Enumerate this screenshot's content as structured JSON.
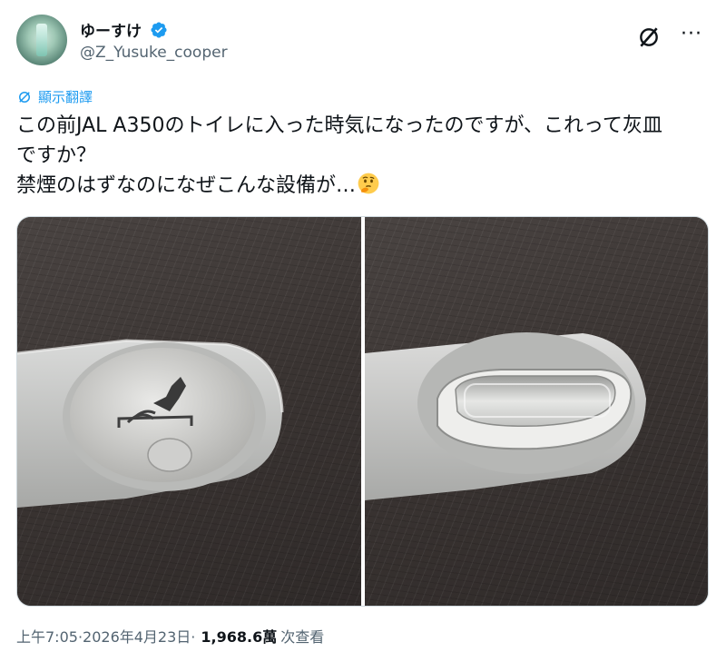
{
  "author": {
    "display_name": "ゆーすけ",
    "handle": "@Z_Yusuke_cooper",
    "verified": true
  },
  "icons": {
    "grok": "grok-icon",
    "more": "more-icon",
    "translate": "translate-icon",
    "verified": "verified-badge-icon",
    "thinking_emoji": "thinking-face-emoji"
  },
  "translate_label": "顯示翻譯",
  "tweet_text": "この前JAL A350のトイレに入った時気になったのですが、これって灰皿\nですか？\n禁煙のはずなのになぜこんな設備が…",
  "media": {
    "count": 2
  },
  "footer": {
    "time": "上午7:05",
    "separator": " · ",
    "date": "2026年4月23日",
    "separator2": " · ",
    "views_count": "1,968.6萬",
    "views_label": "次查看"
  },
  "colors": {
    "accent": "#1d9bf0",
    "text": "#0f1419",
    "muted": "#536471"
  }
}
